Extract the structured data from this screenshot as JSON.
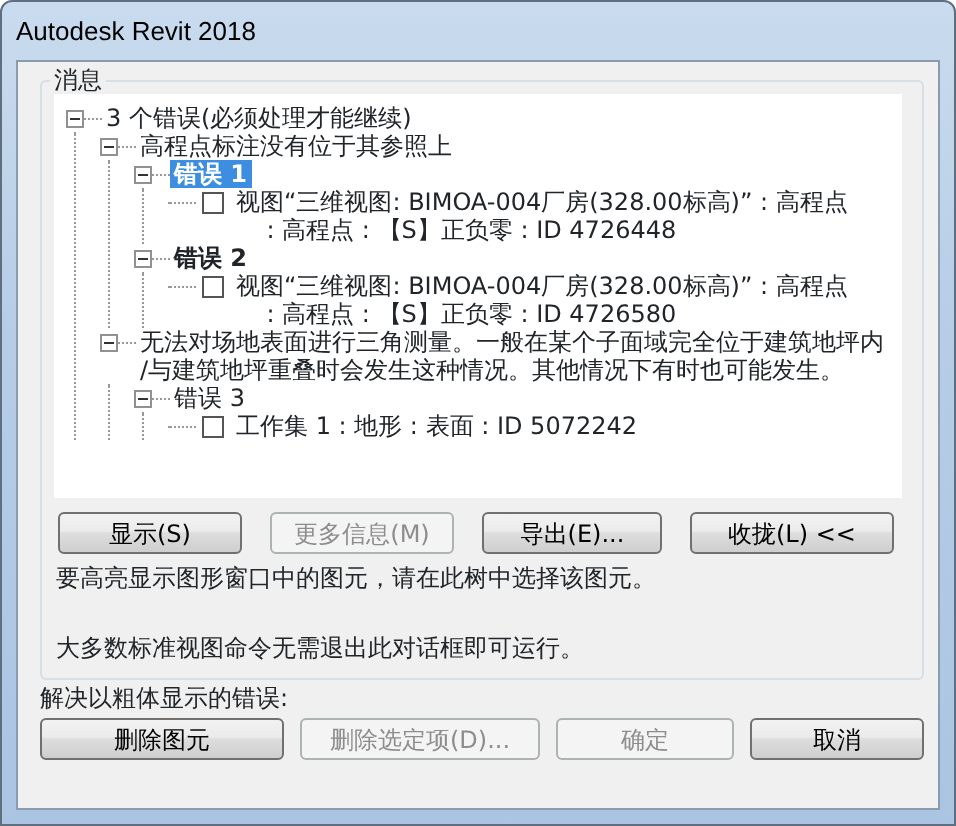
{
  "window": {
    "title": "Autodesk Revit 2018"
  },
  "messages": {
    "legend": "消息",
    "tree": [
      {
        "kind": "node",
        "label": "3 个错误(必须处理才能继续)",
        "bold": false,
        "selected": false,
        "expanded": true,
        "children": [
          {
            "kind": "node",
            "label": "高程点标注没有位于其参照上",
            "bold": false,
            "selected": false,
            "expanded": true,
            "children": [
              {
                "kind": "node",
                "label": "错误 1",
                "bold": true,
                "selected": true,
                "expanded": true,
                "children": [
                  {
                    "kind": "leaf",
                    "checked": false,
                    "lines": [
                      "视图“三维视图: BIMOA-004厂房(328.00标高)” : 高程点",
                      ": 高程点 : 【S】正负零 : ID 4726448"
                    ]
                  }
                ]
              },
              {
                "kind": "node",
                "label": "错误 2",
                "bold": true,
                "selected": false,
                "expanded": true,
                "children": [
                  {
                    "kind": "leaf",
                    "checked": false,
                    "lines": [
                      "视图“三维视图: BIMOA-004厂房(328.00标高)” : 高程点",
                      ": 高程点 : 【S】正负零 : ID 4726580"
                    ]
                  }
                ]
              }
            ]
          },
          {
            "kind": "node",
            "lines": [
              "无法对场地表面进行三角测量。一般在某个子面域完全位于建筑地坪内",
              "/与建筑地坪重叠时会发生这种情况。其他情况下有时也可能发生。"
            ],
            "bold": false,
            "selected": false,
            "expanded": true,
            "children": [
              {
                "kind": "node",
                "label": "错误 3",
                "bold": false,
                "selected": false,
                "expanded": true,
                "children": [
                  {
                    "kind": "leaf",
                    "checked": false,
                    "lines": [
                      "工作集 1 : 地形 : 表面 : ID 5072242"
                    ]
                  }
                ]
              }
            ]
          }
        ]
      }
    ],
    "buttons": [
      {
        "label": "显示(S)",
        "disabled": false
      },
      {
        "label": "更多信息(M)",
        "disabled": true
      },
      {
        "label": "导出(E)...",
        "disabled": false
      },
      {
        "label": "收拢(L) <<",
        "disabled": false
      }
    ],
    "hints": [
      "要高亮显示图形窗口中的图元，请在此树中选择该图元。",
      "大多数标准视图命令无需退出此对话框即可运行。"
    ]
  },
  "resolve": {
    "label": "解决以粗体显示的错误:",
    "buttons": [
      {
        "label": "删除图元",
        "disabled": false
      },
      {
        "label": "删除选定项(D)...",
        "disabled": true
      },
      {
        "label": "确定",
        "disabled": true
      },
      {
        "label": "取消",
        "disabled": false
      }
    ]
  }
}
